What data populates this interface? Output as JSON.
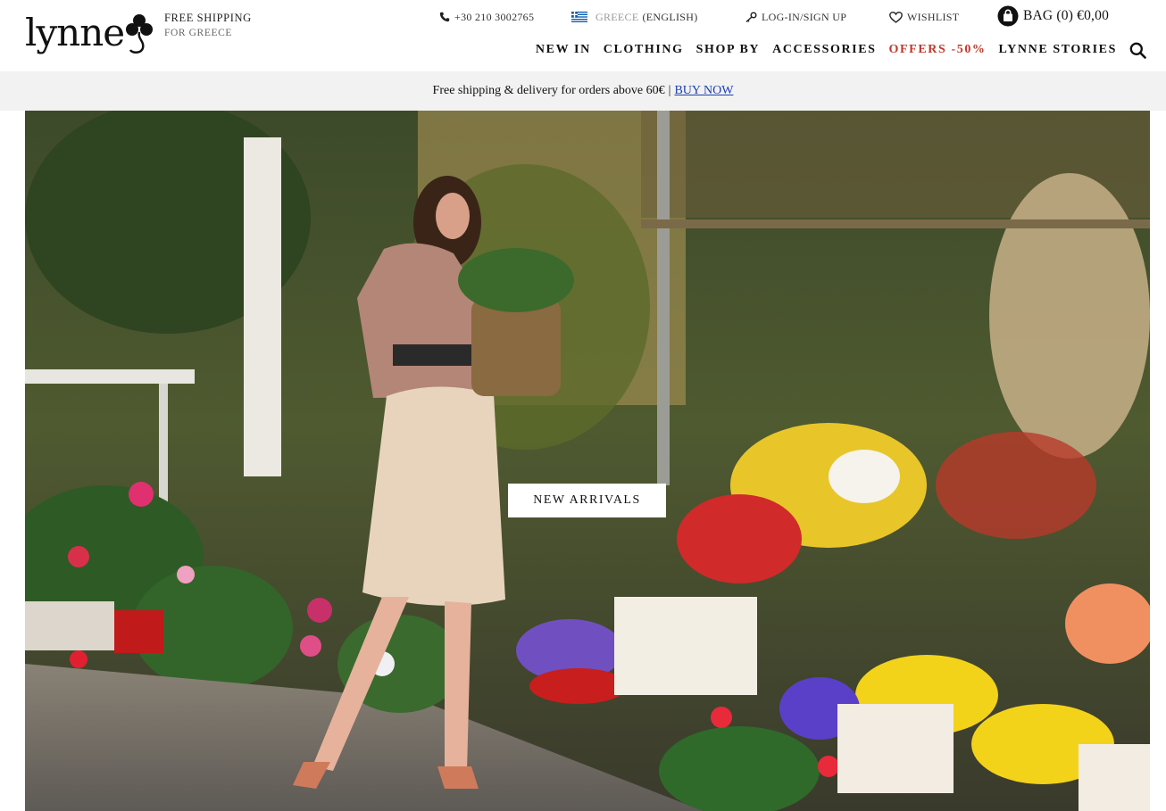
{
  "brand": {
    "logo_text": "lynne",
    "shipping_title": "FREE SHIPPING",
    "shipping_sub": "FOR GREECE"
  },
  "topbar": {
    "phone": "+30 210 3002765",
    "country": "GREECE",
    "language": "(ENGLISH)",
    "login": "LOG-IN/SIGN UP",
    "wishlist": "WISHLIST",
    "bag": "BAG (0) €0,00"
  },
  "nav": {
    "items": [
      "NEW IN",
      "CLOTHING",
      "SHOP BY",
      "ACCESSORIES",
      "OFFERS -50%",
      "LYNNE STORIES"
    ],
    "sale_color": "#c0392b"
  },
  "promo": {
    "text": "Free shipping & delivery for orders above 60€",
    "separator": "|",
    "link": "BUY NOW"
  },
  "hero": {
    "cta": "NEW ARRIVALS"
  },
  "icons": [
    "phone-icon",
    "greece-flag-icon",
    "key-icon",
    "heart-icon",
    "bag-icon",
    "search-icon",
    "clover-logo-icon"
  ],
  "colors": {
    "promo_bg": "#f2f2f2",
    "link": "#1a3fb0",
    "text": "#111111"
  }
}
